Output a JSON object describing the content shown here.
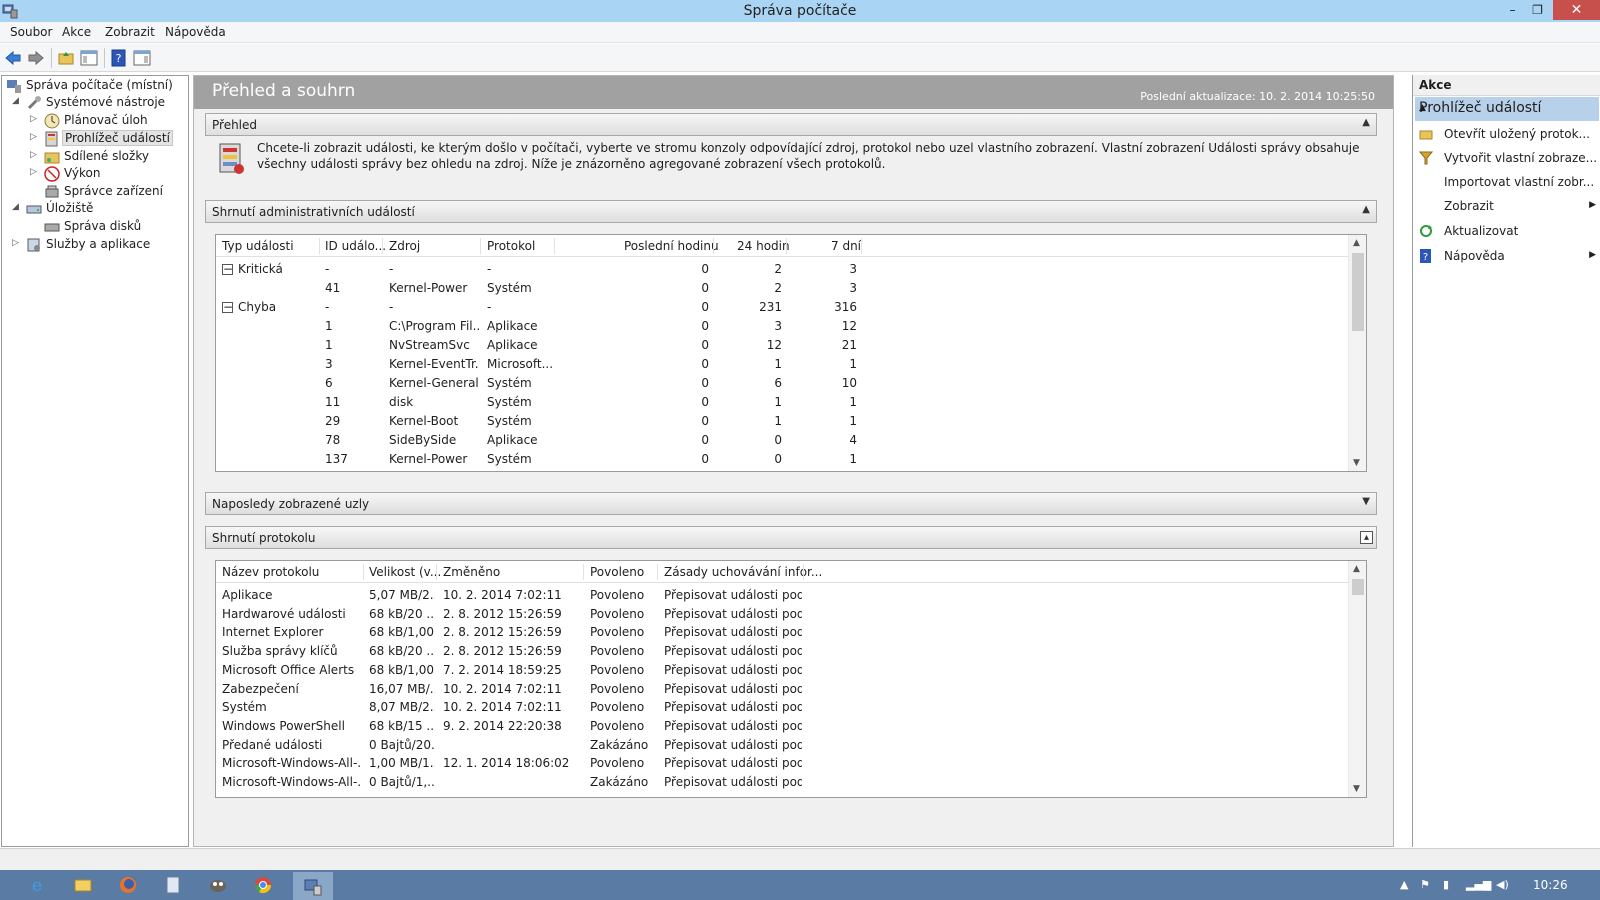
{
  "window": {
    "title": "Správa počítače",
    "controls": {
      "minimize": "–",
      "maximize": "❐",
      "close": "✕"
    }
  },
  "menu": [
    "Soubor",
    "Akce",
    "Zobrazit",
    "Nápověda"
  ],
  "toolbar": {
    "icons": [
      "back-arrow-icon",
      "forward-arrow-icon",
      "up-folder-icon",
      "show-hide-tree-icon",
      "help-icon",
      "show-hide-action-pane-icon"
    ]
  },
  "tree": {
    "root": "Správa počítače (místní)",
    "system_tools": "Systémové nástroje",
    "task_scheduler": "Plánovač úloh",
    "event_viewer": "Prohlížeč událostí",
    "shared_folders": "Sdílené složky",
    "performance": "Výkon",
    "device_manager": "Správce zařízení",
    "storage": "Úložiště",
    "disk_management": "Správa disků",
    "services_apps": "Služby a aplikace"
  },
  "center": {
    "title": "Přehled a souhrn",
    "last_update": "Poslední aktualizace: 10. 2. 2014 10:25:50",
    "overview": {
      "title": "Přehled",
      "text": "Chcete-li zobrazit události, ke kterým došlo v počítači, vyberte ve stromu konzoly odpovídající zdroj, protokol nebo uzel vlastního zobrazení. Vlastní zobrazení Události správy obsahuje všechny události správy bez ohledu na zdroj. Níže je znázorněno agregované zobrazení všech protokolů."
    },
    "admin_summary": {
      "title": "Shrnutí administrativních událostí",
      "columns": [
        "Typ události",
        "ID událo...",
        "Zdroj",
        "Protokol",
        "Poslední hodinu",
        "24 hodin",
        "7 dní"
      ],
      "rows": [
        {
          "type": "Kritická",
          "id": "-",
          "source": "-",
          "log": "-",
          "hour": "0",
          "day": "2",
          "week": "3",
          "group": true
        },
        {
          "type": "",
          "id": "41",
          "source": "Kernel-Power",
          "log": "Systém",
          "hour": "0",
          "day": "2",
          "week": "3"
        },
        {
          "type": "Chyba",
          "id": "-",
          "source": "-",
          "log": "-",
          "hour": "0",
          "day": "231",
          "week": "316",
          "group": true
        },
        {
          "type": "",
          "id": "1",
          "source": "C:\\Program Fil...",
          "log": "Aplikace",
          "hour": "0",
          "day": "3",
          "week": "12"
        },
        {
          "type": "",
          "id": "1",
          "source": "NvStreamSvc",
          "log": "Aplikace",
          "hour": "0",
          "day": "12",
          "week": "21"
        },
        {
          "type": "",
          "id": "3",
          "source": "Kernel-EventTr...",
          "log": "Microsoft...",
          "hour": "0",
          "day": "1",
          "week": "1"
        },
        {
          "type": "",
          "id": "6",
          "source": "Kernel-General",
          "log": "Systém",
          "hour": "0",
          "day": "6",
          "week": "10"
        },
        {
          "type": "",
          "id": "11",
          "source": "disk",
          "log": "Systém",
          "hour": "0",
          "day": "1",
          "week": "1"
        },
        {
          "type": "",
          "id": "29",
          "source": "Kernel-Boot",
          "log": "Systém",
          "hour": "0",
          "day": "1",
          "week": "1"
        },
        {
          "type": "",
          "id": "78",
          "source": "SideBySide",
          "log": "Aplikace",
          "hour": "0",
          "day": "0",
          "week": "4"
        },
        {
          "type": "",
          "id": "137",
          "source": "Kernel-Power",
          "log": "Systém",
          "hour": "0",
          "day": "0",
          "week": "1"
        }
      ]
    },
    "recent_nodes": {
      "title": "Naposledy zobrazené uzly"
    },
    "log_summary": {
      "title": "Shrnutí protokolu",
      "columns": [
        "Název protokolu",
        "Velikost (v...",
        "Změněno",
        "Povoleno",
        "Zásady uchovávání infor..."
      ],
      "rows": [
        {
          "name": "Aplikace",
          "size": "5,07 MB/2...",
          "modified": "10. 2. 2014 7:02:11",
          "enabled": "Povoleno",
          "policy": "Přepisovat události podl..."
        },
        {
          "name": "Hardwarové události",
          "size": "68 kB/20 ...",
          "modified": "2. 8. 2012 15:26:59",
          "enabled": "Povoleno",
          "policy": "Přepisovat události podl..."
        },
        {
          "name": "Internet Explorer",
          "size": "68 kB/1,00...",
          "modified": "2. 8. 2012 15:26:59",
          "enabled": "Povoleno",
          "policy": "Přepisovat události podl..."
        },
        {
          "name": "Služba správy klíčů",
          "size": "68 kB/20 ...",
          "modified": "2. 8. 2012 15:26:59",
          "enabled": "Povoleno",
          "policy": "Přepisovat události podl..."
        },
        {
          "name": "Microsoft Office Alerts",
          "size": "68 kB/1,00...",
          "modified": "7. 2. 2014 18:59:25",
          "enabled": "Povoleno",
          "policy": "Přepisovat události podl..."
        },
        {
          "name": "Zabezpečení",
          "size": "16,07 MB/...",
          "modified": "10. 2. 2014 7:02:11",
          "enabled": "Povoleno",
          "policy": "Přepisovat události podl..."
        },
        {
          "name": "Systém",
          "size": "8,07 MB/2...",
          "modified": "10. 2. 2014 7:02:11",
          "enabled": "Povoleno",
          "policy": "Přepisovat události podl..."
        },
        {
          "name": "Windows PowerShell",
          "size": "68 kB/15 ...",
          "modified": "9. 2. 2014 22:20:38",
          "enabled": "Povoleno",
          "policy": "Přepisovat události podl..."
        },
        {
          "name": "Předané události",
          "size": "0 Bajtů/20...",
          "modified": "",
          "enabled": "Zakázáno",
          "policy": "Přepisovat události podl..."
        },
        {
          "name": "Microsoft-Windows-All-...",
          "size": "1,00 MB/1...",
          "modified": "12. 1. 2014 18:06:02",
          "enabled": "Povoleno",
          "policy": "Přepisovat události podl..."
        },
        {
          "name": "Microsoft-Windows-All-...",
          "size": "0 Bajtů/1,...",
          "modified": "",
          "enabled": "Zakázáno",
          "policy": "Přepisovat události podl..."
        }
      ]
    }
  },
  "actions": {
    "header": "Akce",
    "subheader": "Prohlížeč událostí",
    "items": [
      {
        "label": "Otevřít uložený protok...",
        "icon": "open-folder-icon",
        "submenu": false
      },
      {
        "label": "Vytvořit vlastní zobraze...",
        "icon": "filter-icon",
        "submenu": false
      },
      {
        "label": "Importovat vlastní zobr...",
        "icon": "",
        "submenu": false
      },
      {
        "label": "Zobrazit",
        "icon": "",
        "submenu": true
      },
      {
        "label": "Aktualizovat",
        "icon": "refresh-icon",
        "submenu": false
      },
      {
        "label": "Nápověda",
        "icon": "help-icon",
        "submenu": true
      }
    ]
  },
  "taskbar": {
    "apps": [
      "internet-explorer-icon",
      "file-explorer-icon",
      "firefox-icon",
      "notepad-icon",
      "gimp-icon",
      "chrome-icon",
      "computer-management-icon"
    ],
    "clock": "10:26"
  },
  "colors": {
    "titlebar": "#a9d4f3",
    "close_button": "#c7504c",
    "center_header": "#a1a1a1",
    "actions_subheader": "#b7d1ea",
    "taskbar": "#5a7ba4"
  }
}
